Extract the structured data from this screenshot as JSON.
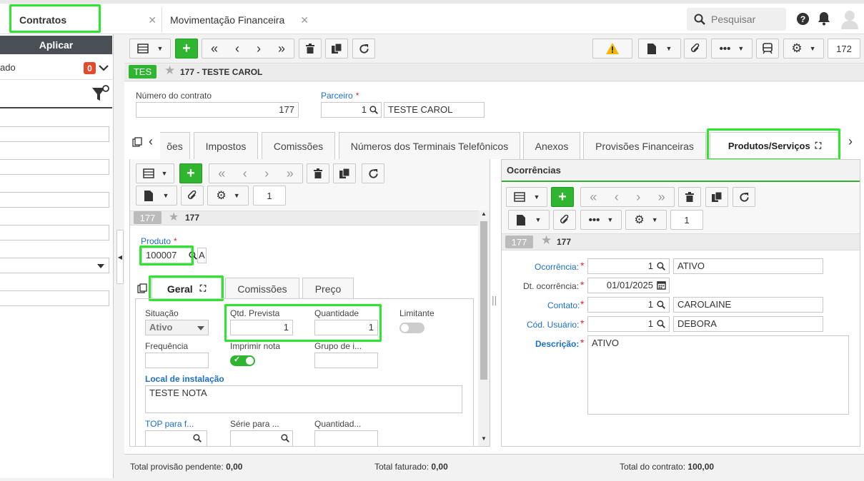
{
  "tabs": [
    {
      "label": "Contratos"
    },
    {
      "label": "Movimentação Financeira"
    }
  ],
  "search": {
    "placeholder": "Pesquisar"
  },
  "left": {
    "apply": "Aplicar",
    "filter_label": "ado",
    "filter_count": "0"
  },
  "toolbar": {
    "page": "172"
  },
  "record": {
    "tag": "TES",
    "title": "177 - TESTE CAROL"
  },
  "form": {
    "contract_label": "Número do contrato",
    "contract_value": "177",
    "partner_label": "Parceiro",
    "partner_code": "1",
    "partner_name": "TESTE CAROL"
  },
  "subtabs": [
    "ões",
    "Impostos",
    "Comissões",
    "Números dos Terminais Telefônicos",
    "Anexos",
    "Provisões Financeiras",
    "Produtos/Serviços"
  ],
  "items": {
    "page": "1",
    "badge": "177",
    "title": "177",
    "product_label": "Produto",
    "product_value": "100007",
    "product_extra": "A"
  },
  "inner_tabs": [
    "Geral",
    "Comissões",
    "Preço"
  ],
  "geral": {
    "situacao_label": "Situação",
    "situacao_value": "Ativo",
    "qtd_prev_label": "Qtd. Prevista",
    "qtd_prev_value": "1",
    "quantidade_label": "Quantidade",
    "quantidade_value": "1",
    "limitante_label": "Limitante",
    "frequencia_label": "Frequência",
    "imprimir_label": "Imprimir nota",
    "grupo_label": "Grupo de i...",
    "local_label": "Local de instalação",
    "local_value": "TESTE NOTA",
    "top_label": "TOP para f...",
    "serie_label": "Série para ...",
    "qtd2_label": "Quantidad..."
  },
  "ocorrencias": {
    "title": "Ocorrências",
    "page": "1",
    "badge": "177",
    "subtitle": "177",
    "ocorrencia_label": "Ocorrência:",
    "ocorrencia_code": "1",
    "ocorrencia_value": "ATIVO",
    "dt_label": "Dt. ocorrência:",
    "dt_value": "01/01/2025",
    "contato_label": "Contato:",
    "contato_code": "1",
    "contato_value": "CAROLAINE",
    "usuario_label": "Cód. Usuário:",
    "usuario_code": "1",
    "usuario_value": "DEBORA",
    "descricao_label": "Descrição:",
    "descricao_value": "ATIVO"
  },
  "footer": {
    "pendente_label": "Total provisão pendente:",
    "pendente_value": "0,00",
    "faturado_label": "Total faturado:",
    "faturado_value": "0,00",
    "contrato_label": "Total do contrato:",
    "contrato_value": "100,00"
  },
  "colors": {
    "green": "#2fb52f",
    "highlight": "#2ee62e",
    "blue": "#1a6fc9",
    "red": "#d9262f"
  }
}
